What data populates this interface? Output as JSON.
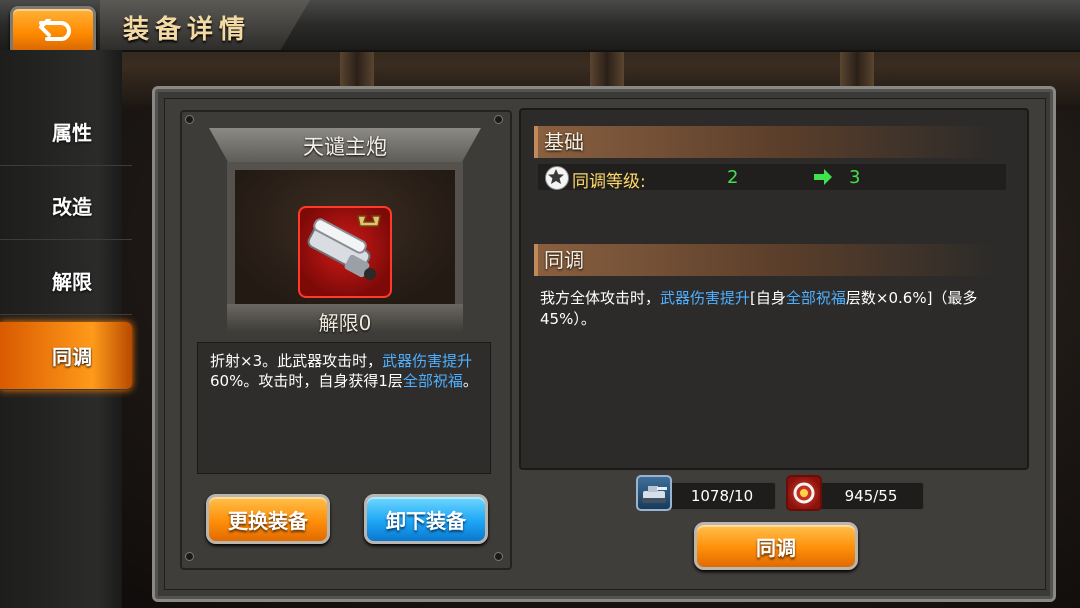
{
  "header": {
    "title": "装备详情",
    "back_icon": "back-arrow-icon"
  },
  "sidebar": {
    "items": [
      {
        "label": "属性",
        "active": false
      },
      {
        "label": "改造",
        "active": false
      },
      {
        "label": "解限",
        "active": false
      },
      {
        "label": "同调",
        "active": true
      }
    ]
  },
  "item": {
    "name": "天谴主炮",
    "level_label": "解限0",
    "icon": "cannon-weapon-icon",
    "description": {
      "part1": "折射×3。此武器攻击时，",
      "hl1": "武器伤害提升",
      "part2": "60%。攻击时，自身获得1层",
      "hl2": "全部祝福",
      "part3": "。"
    }
  },
  "buttons": {
    "replace": "更换装备",
    "unequip": "卸下装备",
    "sync": "同调"
  },
  "basic": {
    "title": "基础",
    "stat_label": "同调等级:",
    "from": "2",
    "to": "3",
    "star_icon": "star-icon",
    "arrow_icon": "green-arrow-right-icon"
  },
  "sync": {
    "title": "同调",
    "text_a": "我方全体攻击时，",
    "hl_a": "武器伤害提升",
    "text_b": "[自身",
    "hl_b": "全部祝福",
    "text_c": "层数×0.6%]（最多45%）。"
  },
  "resources": [
    {
      "value": "1078/10",
      "icon": "tank-material-icon"
    },
    {
      "value": "945/55",
      "icon": "red-core-icon"
    }
  ],
  "colors": {
    "accent_orange": "#ff8f0a",
    "highlight_blue": "#4fb0ff",
    "stat_green": "#42e04a",
    "label_gold": "#ffd86a"
  }
}
